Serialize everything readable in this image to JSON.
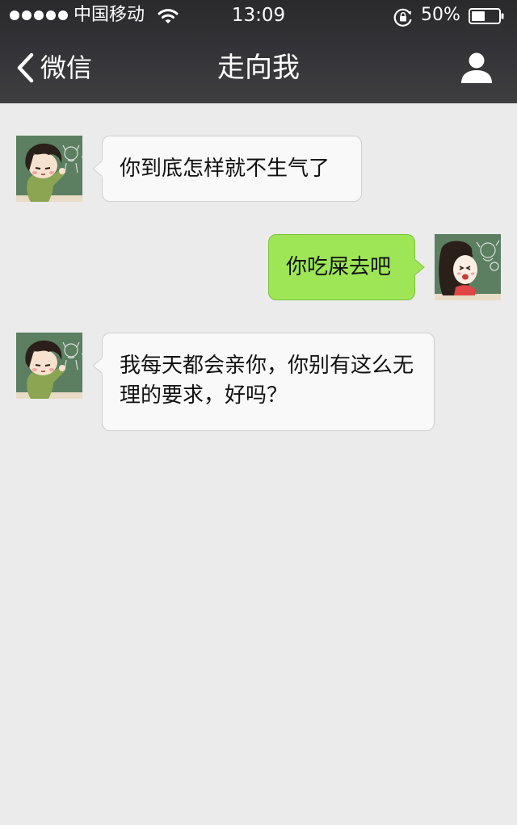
{
  "status_bar": {
    "carrier": "中国移动",
    "time": "13:09",
    "battery_percent": "50%",
    "battery_level": 0.5,
    "icons": [
      "signal-dots-icon",
      "wifi-icon",
      "rotation-lock-icon",
      "battery-icon"
    ]
  },
  "nav": {
    "back_label": "微信",
    "title": "走向我",
    "icons": [
      "chevron-left-icon",
      "person-icon"
    ]
  },
  "messages": [
    {
      "side": "received",
      "text": "你到底怎样就不生气了"
    },
    {
      "side": "sent",
      "text": "你吃屎去吧"
    },
    {
      "side": "received",
      "text": "我每天都会亲你，你别有这么无理的要求，好吗？"
    }
  ],
  "colors": {
    "bar": "#333337",
    "background": "#ebebeb",
    "incoming_bubble": "#f9f9f9",
    "outgoing_bubble": "#9ee656",
    "avatar_board": "#5b7f60"
  }
}
